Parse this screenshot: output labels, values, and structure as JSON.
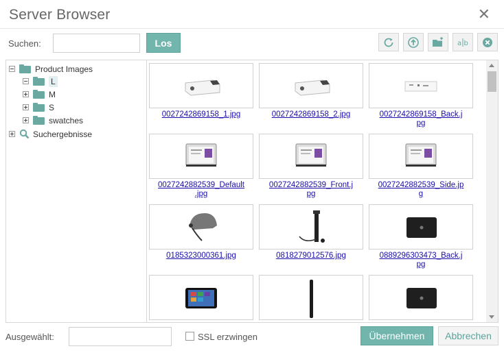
{
  "window": {
    "title": "Server Browser"
  },
  "toolbar": {
    "search_label": "Suchen:",
    "search_value": "",
    "go_label": "Los"
  },
  "tree": {
    "items": [
      {
        "label": "Product Images",
        "icon": "folder-icon",
        "expander": "minus"
      },
      {
        "label": "L",
        "icon": "folder-icon",
        "expander": "minus",
        "selected": true
      },
      {
        "label": "M",
        "icon": "folder-icon",
        "expander": "plus"
      },
      {
        "label": "S",
        "icon": "folder-icon",
        "expander": "plus"
      },
      {
        "label": "swatches",
        "icon": "folder-icon",
        "expander": "plus"
      },
      {
        "label": "Suchergebnisse",
        "icon": "search-icon",
        "expander": "plus"
      }
    ]
  },
  "files": [
    {
      "line1": "0027242869158_1.jpg",
      "line2": "",
      "kind": "projector"
    },
    {
      "line1": "0027242869158_2.jpg",
      "line2": "",
      "kind": "projector"
    },
    {
      "line1": "0027242869158_Back.j",
      "line2": "pg",
      "kind": "projector-back"
    },
    {
      "line1": "0027242882539_Default",
      "line2": ".jpg",
      "kind": "battery"
    },
    {
      "line1": "0027242882539_Front.j",
      "line2": "pg",
      "kind": "battery"
    },
    {
      "line1": "0027242882539_Side.jp",
      "line2": "g",
      "kind": "battery"
    },
    {
      "line1": "0185323000361.jpg",
      "line2": "",
      "kind": "helmet"
    },
    {
      "line1": "0818279012576.jpg",
      "line2": "",
      "kind": "stick"
    },
    {
      "line1": "0889296303473_Back.j",
      "line2": "pg",
      "kind": "laptop"
    },
    {
      "line1": "",
      "line2": "",
      "kind": "tablet"
    },
    {
      "line1": "",
      "line2": "",
      "kind": "pen"
    },
    {
      "line1": "",
      "line2": "",
      "kind": "laptop"
    }
  ],
  "footer": {
    "selected_label": "Ausgewählt:",
    "selected_value": "",
    "ssl_label": "SSL erzwingen",
    "ssl_checked": false,
    "apply_label": "Übernehmen",
    "cancel_label": "Abbrechen"
  },
  "colors": {
    "accent": "#72b5ad",
    "link": "#1a0dab"
  }
}
